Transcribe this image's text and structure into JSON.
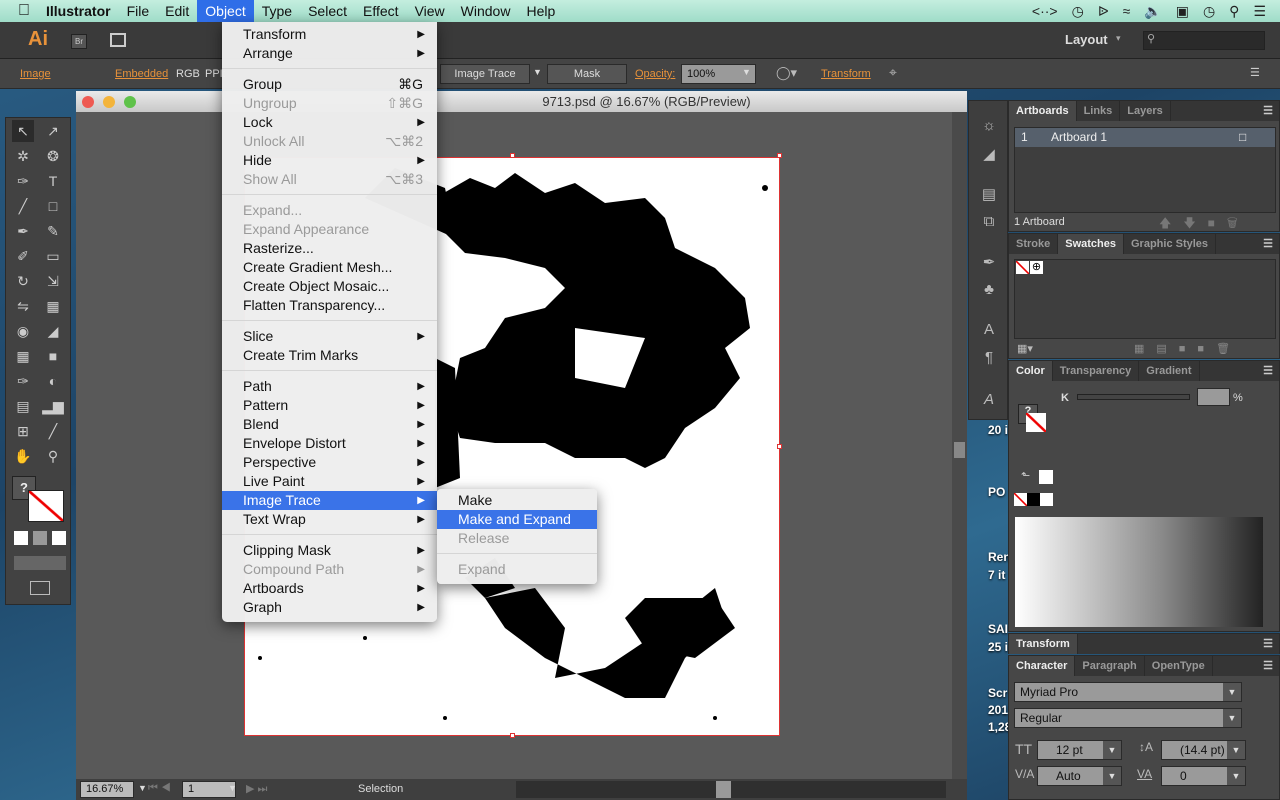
{
  "menubar": {
    "app": "Illustrator",
    "items": [
      "File",
      "Edit",
      "Object",
      "Type",
      "Select",
      "Effect",
      "View",
      "Window",
      "Help"
    ],
    "active": "Object"
  },
  "appbar": {
    "logo": "Ai",
    "bridge": "Br",
    "workspace": "Layout",
    "search_placeholder": ""
  },
  "control": {
    "image": "Image",
    "embedded": "Embedded",
    "rgb": "RGB",
    "ppi": "PPI:",
    "image_trace": "Image Trace",
    "mask": "Mask",
    "opacity_label": "Opacity:",
    "opacity": "100%",
    "transform": "Transform"
  },
  "document": {
    "title": "9713.psd @ 16.67% (RGB/Preview)",
    "zoom": "16.67%",
    "artboard_num": "1",
    "status": "Selection"
  },
  "object_menu": [
    {
      "label": "Transform",
      "sub": true
    },
    {
      "label": "Arrange",
      "sub": true
    },
    {
      "sep": true
    },
    {
      "label": "Group",
      "shortcut": "⌘G"
    },
    {
      "label": "Ungroup",
      "shortcut": "⇧⌘G",
      "disabled": true
    },
    {
      "label": "Lock",
      "sub": true
    },
    {
      "label": "Unlock All",
      "shortcut": "⌥⌘2",
      "disabled": true
    },
    {
      "label": "Hide",
      "sub": true
    },
    {
      "label": "Show All",
      "shortcut": "⌥⌘3",
      "disabled": true
    },
    {
      "sep": true
    },
    {
      "label": "Expand...",
      "disabled": true
    },
    {
      "label": "Expand Appearance",
      "disabled": true
    },
    {
      "label": "Rasterize..."
    },
    {
      "label": "Create Gradient Mesh..."
    },
    {
      "label": "Create Object Mosaic..."
    },
    {
      "label": "Flatten Transparency..."
    },
    {
      "sep": true
    },
    {
      "label": "Slice",
      "sub": true
    },
    {
      "label": "Create Trim Marks"
    },
    {
      "sep": true
    },
    {
      "label": "Path",
      "sub": true
    },
    {
      "label": "Pattern",
      "sub": true
    },
    {
      "label": "Blend",
      "sub": true
    },
    {
      "label": "Envelope Distort",
      "sub": true
    },
    {
      "label": "Perspective",
      "sub": true
    },
    {
      "label": "Live Paint",
      "sub": true
    },
    {
      "label": "Image Trace",
      "sub": true,
      "highlighted": true
    },
    {
      "label": "Text Wrap",
      "sub": true
    },
    {
      "sep": true
    },
    {
      "label": "Clipping Mask",
      "sub": true
    },
    {
      "label": "Compound Path",
      "sub": true,
      "disabled": true
    },
    {
      "label": "Artboards",
      "sub": true
    },
    {
      "label": "Graph",
      "sub": true
    }
  ],
  "image_trace_submenu": [
    {
      "label": "Make"
    },
    {
      "label": "Make and Expand",
      "highlighted": true
    },
    {
      "label": "Release",
      "disabled": true
    },
    {
      "sep": true
    },
    {
      "label": "Expand",
      "disabled": true
    }
  ],
  "artboards_panel": {
    "tabs": [
      "Artboards",
      "Links",
      "Layers"
    ],
    "rows": [
      {
        "num": "1",
        "name": "Artboard 1"
      }
    ],
    "footer": "1 Artboard"
  },
  "swatches_panel": {
    "tabs": [
      "Stroke",
      "Swatches",
      "Graphic Styles"
    ]
  },
  "color_panel": {
    "tabs": [
      "Color",
      "Transparency",
      "Gradient"
    ],
    "channel": "K",
    "unit": "%"
  },
  "transform_panel": {
    "title": "Transform"
  },
  "character_panel": {
    "tabs": [
      "Character",
      "Paragraph",
      "OpenType"
    ],
    "font": "Myriad Pro",
    "style": "Regular",
    "size": "12 pt",
    "leading": "(14.4 pt)",
    "kerning": "Auto",
    "tracking": "0"
  },
  "desktop": [
    "20 i",
    "PO",
    "Ren",
    "7 it",
    "SAI",
    "25 i",
    "Scr",
    "201",
    "1,28"
  ],
  "colors": {
    "highlight": "#3a73e8",
    "accent": "#e8923a"
  }
}
